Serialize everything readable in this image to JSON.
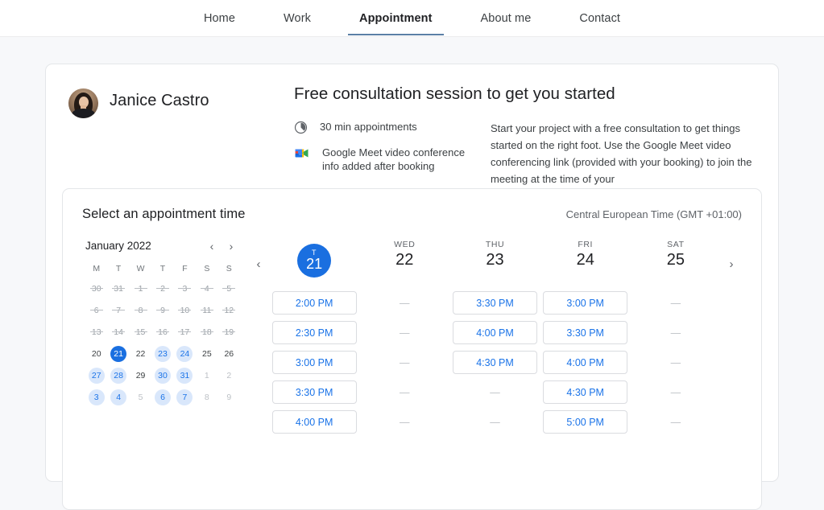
{
  "nav": {
    "items": [
      {
        "label": "Home",
        "active": false
      },
      {
        "label": "Work",
        "active": false
      },
      {
        "label": "Appointment",
        "active": true
      },
      {
        "label": "About me",
        "active": false
      },
      {
        "label": "Contact",
        "active": false
      }
    ]
  },
  "profile": {
    "name": "Janice Castro",
    "avatar_icon": "user-photo-avatar"
  },
  "session": {
    "title": "Free consultation session to get you started",
    "duration_icon": "clock-icon",
    "duration_text": "30 min appointments",
    "meet_icon": "google-meet-icon",
    "meet_text": "Google Meet video conference info added after booking",
    "description": "Start your project with a free consultation to get things started on the right foot. Use the Google Meet video conferencing link (provided with your booking) to join the meeting at the time of your"
  },
  "booking": {
    "title": "Select an appointment time",
    "timezone": "Central European Time (GMT +01:00)",
    "calendar": {
      "month_label": "January 2022",
      "prev_icon": "chevron-left-icon",
      "next_icon": "chevron-right-icon",
      "dow": [
        "M",
        "T",
        "W",
        "T",
        "F",
        "S",
        "S"
      ],
      "weeks": [
        [
          {
            "n": "30",
            "state": "past"
          },
          {
            "n": "31",
            "state": "past"
          },
          {
            "n": "1",
            "state": "past"
          },
          {
            "n": "2",
            "state": "past"
          },
          {
            "n": "3",
            "state": "past"
          },
          {
            "n": "4",
            "state": "past"
          },
          {
            "n": "5",
            "state": "past"
          }
        ],
        [
          {
            "n": "6",
            "state": "past"
          },
          {
            "n": "7",
            "state": "past"
          },
          {
            "n": "8",
            "state": "past"
          },
          {
            "n": "9",
            "state": "past"
          },
          {
            "n": "10",
            "state": "past"
          },
          {
            "n": "11",
            "state": "past"
          },
          {
            "n": "12",
            "state": "past"
          }
        ],
        [
          {
            "n": "13",
            "state": "past"
          },
          {
            "n": "14",
            "state": "past"
          },
          {
            "n": "15",
            "state": "past"
          },
          {
            "n": "16",
            "state": "past"
          },
          {
            "n": "17",
            "state": "past"
          },
          {
            "n": "18",
            "state": "past"
          },
          {
            "n": "19",
            "state": "past"
          }
        ],
        [
          {
            "n": "20",
            "state": "normal"
          },
          {
            "n": "21",
            "state": "sel"
          },
          {
            "n": "22",
            "state": "normal"
          },
          {
            "n": "23",
            "state": "avail"
          },
          {
            "n": "24",
            "state": "avail"
          },
          {
            "n": "25",
            "state": "normal"
          },
          {
            "n": "26",
            "state": "normal"
          }
        ],
        [
          {
            "n": "27",
            "state": "avail"
          },
          {
            "n": "28",
            "state": "avail"
          },
          {
            "n": "29",
            "state": "normal"
          },
          {
            "n": "30",
            "state": "avail"
          },
          {
            "n": "31",
            "state": "avail"
          },
          {
            "n": "1",
            "state": "out"
          },
          {
            "n": "2",
            "state": "out"
          }
        ],
        [
          {
            "n": "3",
            "state": "avail"
          },
          {
            "n": "4",
            "state": "avail"
          },
          {
            "n": "5",
            "state": "out"
          },
          {
            "n": "6",
            "state": "avail"
          },
          {
            "n": "7",
            "state": "avail"
          },
          {
            "n": "8",
            "state": "out"
          },
          {
            "n": "9",
            "state": "out"
          }
        ]
      ]
    },
    "prev_week_icon": "chevron-left-icon",
    "next_week_icon": "chevron-right-icon",
    "days": [
      {
        "dow": "T",
        "num": "21",
        "selected": true,
        "slots": [
          "2:00 PM",
          "2:30 PM",
          "3:00 PM",
          "3:30 PM",
          "4:00 PM"
        ]
      },
      {
        "dow": "WED",
        "num": "22",
        "selected": false,
        "slots": [
          "—",
          "—",
          "—",
          "—",
          "—"
        ]
      },
      {
        "dow": "THU",
        "num": "23",
        "selected": false,
        "slots": [
          "3:30 PM",
          "4:00 PM",
          "4:30 PM",
          "—",
          "—"
        ]
      },
      {
        "dow": "FRI",
        "num": "24",
        "selected": false,
        "slots": [
          "3:00 PM",
          "3:30 PM",
          "4:00 PM",
          "4:30 PM",
          "5:00 PM"
        ]
      },
      {
        "dow": "SAT",
        "num": "25",
        "selected": false,
        "slots": [
          "—",
          "—",
          "—",
          "—",
          "—"
        ]
      }
    ]
  },
  "colors": {
    "accent_blue": "#1a73e8",
    "selected_blue": "#1a6fe0",
    "available_bg": "#d9e7fb",
    "page_bg": "#f7f8fa"
  }
}
